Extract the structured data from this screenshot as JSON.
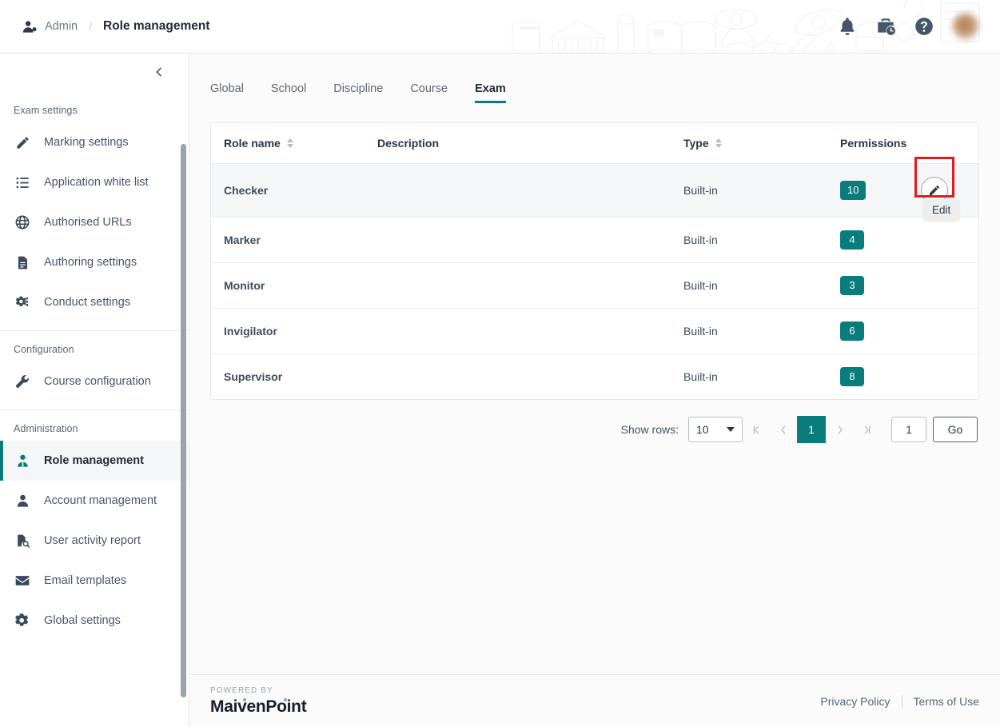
{
  "header": {
    "breadcrumb_root": "Admin",
    "breadcrumb_separator": "/",
    "breadcrumb_current": "Role management",
    "icons": [
      "admin-user-icon",
      "notification-bell-icon",
      "briefcase-clock-icon",
      "help-icon",
      "user-avatar"
    ]
  },
  "sidebar": {
    "collapse_icon": "chevron-left-icon",
    "groups": [
      {
        "label": "Exam settings",
        "items": [
          {
            "label": "Marking settings",
            "icon": "pencil-icon",
            "active": false
          },
          {
            "label": "Application white list",
            "icon": "list-icon",
            "active": false
          },
          {
            "label": "Authorised URLs",
            "icon": "globe-icon",
            "active": false
          },
          {
            "label": "Authoring settings",
            "icon": "document-icon",
            "active": false
          },
          {
            "label": "Conduct settings",
            "icon": "gears-icon",
            "active": false
          }
        ]
      },
      {
        "label": "Configuration",
        "items": [
          {
            "label": "Course configuration",
            "icon": "wrench-icon",
            "active": false
          }
        ]
      },
      {
        "label": "Administration",
        "items": [
          {
            "label": "Role management",
            "icon": "role-user-icon",
            "active": true
          },
          {
            "label": "Account management",
            "icon": "person-icon",
            "active": false
          },
          {
            "label": "User activity report",
            "icon": "report-search-icon",
            "active": false
          },
          {
            "label": "Email templates",
            "icon": "envelope-icon",
            "active": false
          },
          {
            "label": "Global settings",
            "icon": "gear-icon",
            "active": false
          }
        ]
      }
    ]
  },
  "tabs": [
    {
      "label": "Global",
      "active": false
    },
    {
      "label": "School",
      "active": false
    },
    {
      "label": "Discipline",
      "active": false
    },
    {
      "label": "Course",
      "active": false
    },
    {
      "label": "Exam",
      "active": true
    }
  ],
  "table": {
    "columns": [
      {
        "label": "Role name",
        "sortable": true
      },
      {
        "label": "Description",
        "sortable": false
      },
      {
        "label": "Type",
        "sortable": true
      },
      {
        "label": "Permissions",
        "sortable": false
      },
      {
        "label": "",
        "sortable": false
      }
    ],
    "rows": [
      {
        "name": "Checker",
        "description": "",
        "type": "Built-in",
        "permissions": "10",
        "hovered": true
      },
      {
        "name": "Marker",
        "description": "",
        "type": "Built-in",
        "permissions": "4",
        "hovered": false
      },
      {
        "name": "Monitor",
        "description": "",
        "type": "Built-in",
        "permissions": "3",
        "hovered": false
      },
      {
        "name": "Invigilator",
        "description": "",
        "type": "Built-in",
        "permissions": "6",
        "hovered": false
      },
      {
        "name": "Supervisor",
        "description": "",
        "type": "Built-in",
        "permissions": "8",
        "hovered": false
      }
    ],
    "edit_tooltip": "Edit",
    "edit_icon": "pencil-edit-icon"
  },
  "pagination": {
    "show_rows_label": "Show rows:",
    "rows_per_page": "10",
    "first_icon": "first-page-icon",
    "prev_icon": "prev-page-icon",
    "current_page": "1",
    "next_icon": "next-page-icon",
    "last_icon": "last-page-icon",
    "goto_value": "1",
    "go_label": "Go"
  },
  "footer": {
    "powered_by": "POWERED BY",
    "brand": "MaivenPoint",
    "privacy": "Privacy Policy",
    "terms": "Terms of Use"
  },
  "colors": {
    "accent_teal": "#0a7c7c",
    "highlight_red": "#e01b1b",
    "text_dark": "#2b3644",
    "text_muted": "#5a6775"
  }
}
